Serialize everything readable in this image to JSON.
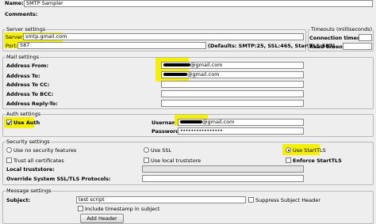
{
  "header": {
    "name_label": "Name:",
    "name_value": "SMTP Sampler",
    "comments_label": "Comments:"
  },
  "server": {
    "title": "Server settings",
    "server_label": "Server:",
    "server_value": "smtp.gmail.com",
    "port_label": "Port:",
    "port_value": "587",
    "defaults_text": "(Defaults: SMTP:25, SSL:465, StartTLS:587)"
  },
  "timeouts": {
    "title": "Timeouts (milliseconds)",
    "connection_label": "Connection timeout:",
    "connection_value": "",
    "read_label": "Read timeout:",
    "read_value": ""
  },
  "mail": {
    "title": "Mail settings",
    "from_label": "Address From:",
    "from_value": "@gmail.com",
    "to_label": "Address To:",
    "to_value": "@gmail.com",
    "cc_label": "Address To CC:",
    "bcc_label": "Address To BCC:",
    "reply_label": "Address Reply-To:"
  },
  "auth": {
    "title": "Auth settings",
    "use_auth_label": "Use Auth",
    "use_auth_checked": true,
    "username_label": "Username:",
    "username_value": "@gmail.com",
    "password_label": "Password:",
    "password_value": "••••••••••••••••"
  },
  "security": {
    "title": "Security settings",
    "no_security_label": "Use no security features",
    "ssl_label": "Use SSL",
    "starttls_label": "Use StartTLS",
    "selected": "starttls",
    "trust_label": "Trust all certificates",
    "local_truststore_chk_label": "Use local truststore",
    "enforce_label": "Enforce StartTLS",
    "local_truststore_label": "Local truststore:",
    "override_label": "Override System SSL/TLS Protocols:"
  },
  "message": {
    "title": "Message settings",
    "subject_label": "Subject:",
    "subject_value": "test script",
    "suppress_label": "Suppress Subject Header",
    "timestamp_label": "Include timestamp in subject",
    "add_header_label": "Add Header"
  },
  "colors": {
    "highlight": "#f5f000",
    "panel": "#eeeeee"
  }
}
